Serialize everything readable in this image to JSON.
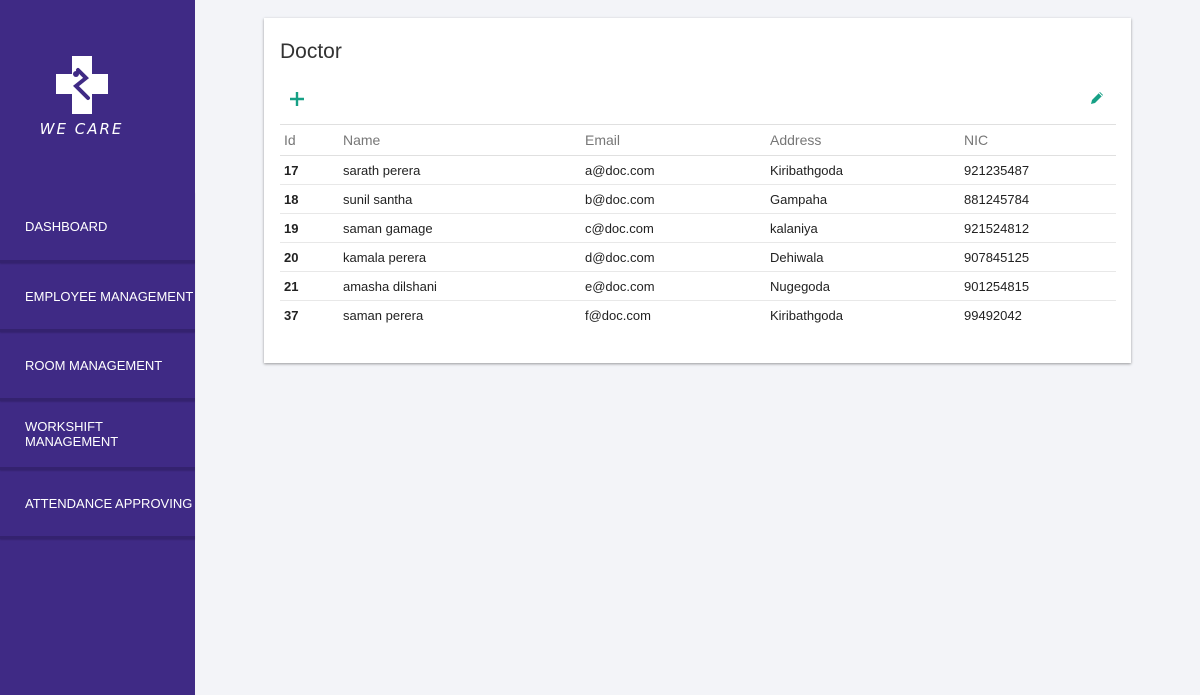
{
  "brand": {
    "name": "WE CARE"
  },
  "nav": {
    "items": [
      {
        "label": "DASHBOARD"
      },
      {
        "label": "EMPLOYEE MANAGEMENT"
      },
      {
        "label": "ROOM MANAGEMENT"
      },
      {
        "label": "WORKSHIFT MANAGEMENT"
      },
      {
        "label": "ATTENDANCE APPROVING"
      }
    ]
  },
  "card": {
    "title": "Doctor",
    "add_icon": "plus-icon",
    "edit_icon": "pencil-icon",
    "accent_color": "#16a085"
  },
  "table": {
    "columns": [
      "Id",
      "Name",
      "Email",
      "Address",
      "NIC"
    ],
    "rows": [
      [
        "17",
        "sarath perera",
        "a@doc.com",
        "Kiribathgoda",
        "921235487"
      ],
      [
        "18",
        "sunil santha",
        "b@doc.com",
        "Gampaha",
        "881245784"
      ],
      [
        "19",
        "saman gamage",
        "c@doc.com",
        "kalaniya",
        "921524812"
      ],
      [
        "20",
        "kamala perera",
        "d@doc.com",
        "Dehiwala",
        "907845125"
      ],
      [
        "21",
        "amasha dilshani",
        "e@doc.com",
        "Nugegoda",
        "901254815"
      ],
      [
        "37",
        "saman perera",
        "f@doc.com",
        "Kiribathgoda",
        "99492042"
      ]
    ]
  },
  "colors": {
    "sidebar": "#3f2a85",
    "background": "#f3f4f8"
  }
}
